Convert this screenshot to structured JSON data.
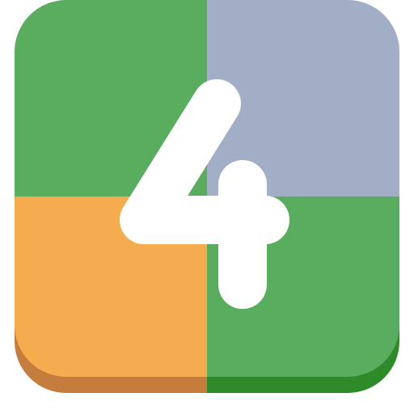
{
  "icon": {
    "name": "number-four-app-icon",
    "glyph": "4",
    "colors": {
      "top_left": "#5aad5e",
      "top_right": "#a2adc6",
      "bottom_left": "#f5ac4f",
      "bottom_right": "#5aad5e",
      "base_left": "#c47d3c",
      "base_right": "#2f8a2a",
      "glyph": "#ffffff"
    }
  }
}
